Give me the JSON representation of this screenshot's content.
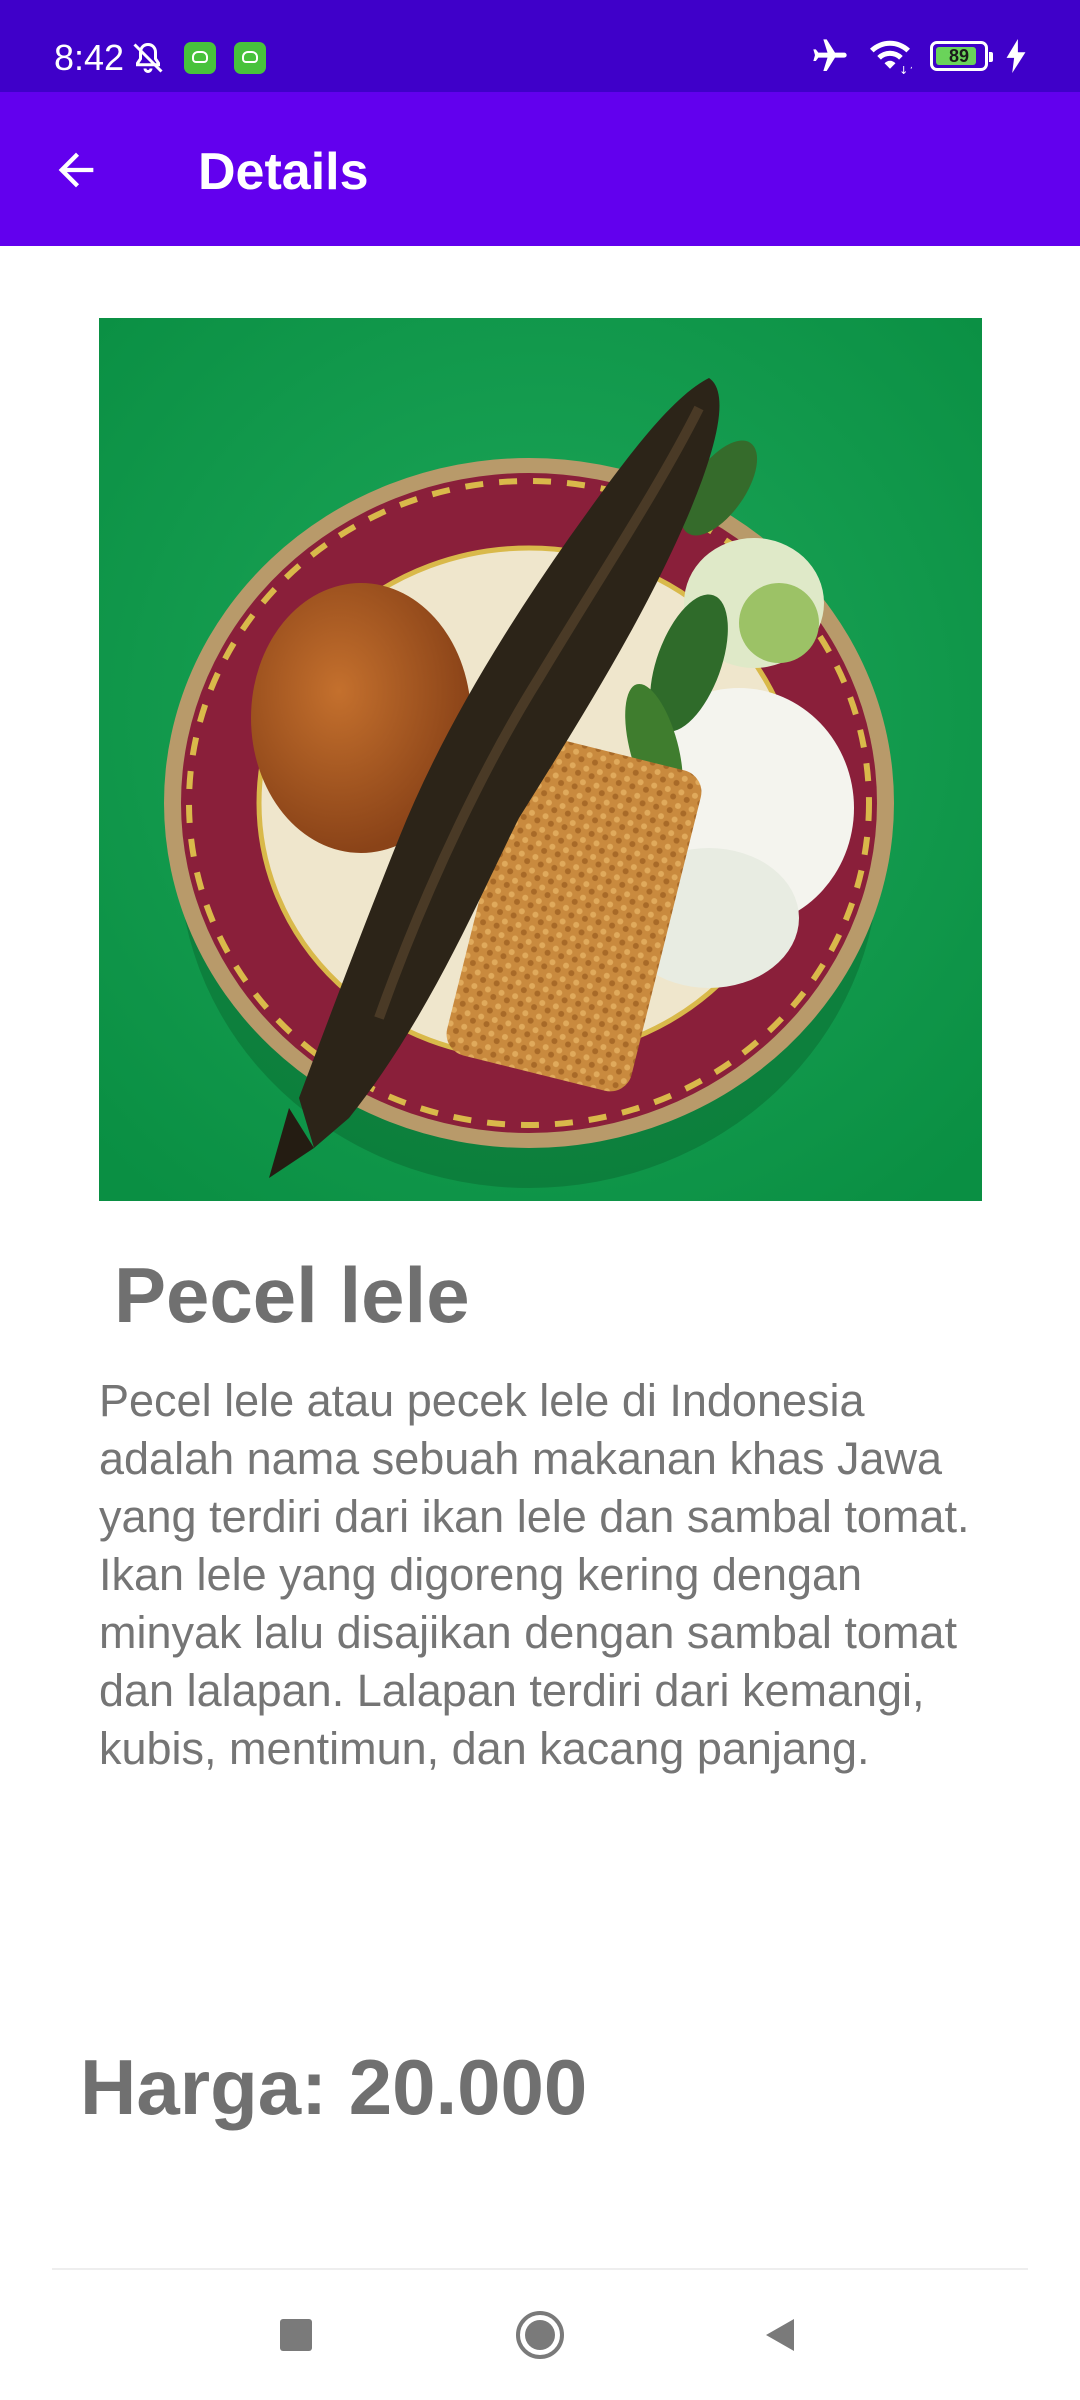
{
  "status_bar": {
    "time": "8:42",
    "battery_level": "89",
    "icons": [
      "mute-bell-icon",
      "app-notification-icon",
      "app-notification-icon",
      "airplane-icon",
      "wifi-icon",
      "battery-icon",
      "charging-icon"
    ]
  },
  "app_bar": {
    "title": "Details",
    "back_icon": "arrow-left-icon"
  },
  "detail": {
    "image": "food-photo",
    "name": "Pecel lele",
    "description": "Pecel lele atau pecek lele di Indonesia adalah nama sebuah makanan khas Jawa yang terdiri dari ikan lele dan sambal tomat. Ikan lele yang digoreng kering dengan minyak lalu disajikan dengan sambal tomat dan lalapan. Lalapan terdiri dari kemangi, kubis, mentimun, dan kacang panjang.",
    "price": "Harga: 20.000"
  },
  "nav_bar": {
    "buttons": [
      "recents-square-icon",
      "home-circle-icon",
      "back-triangle-icon"
    ]
  },
  "colors": {
    "status_bar": "#3f00c9",
    "app_bar": "#6200ee",
    "text_gray": "#707070"
  }
}
